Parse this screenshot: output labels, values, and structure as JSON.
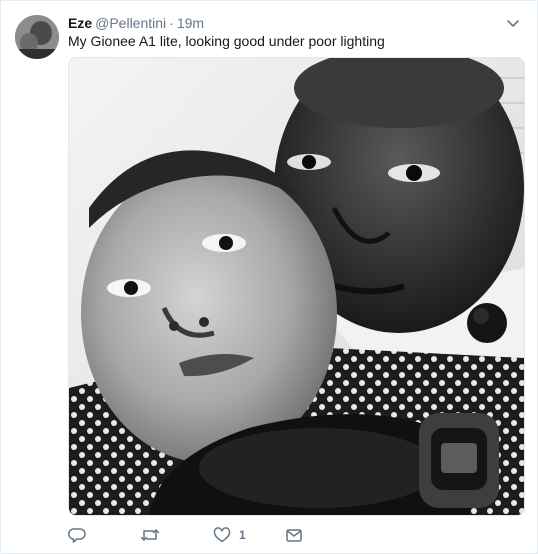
{
  "tweet": {
    "author_name": "Eze",
    "handle": "@Pellentini",
    "separator": "·",
    "time": "19m",
    "text": "My Gionee A1 lite, looking good under poor lighting"
  },
  "actions": {
    "reply_icon": "reply-icon",
    "retweet_icon": "retweet-icon",
    "like_icon": "heart-icon",
    "like_count": "1",
    "dm_icon": "envelope-icon"
  },
  "colors": {
    "secondary_text": "#657786",
    "primary_text": "#14171a",
    "border": "#e6ecf0"
  }
}
